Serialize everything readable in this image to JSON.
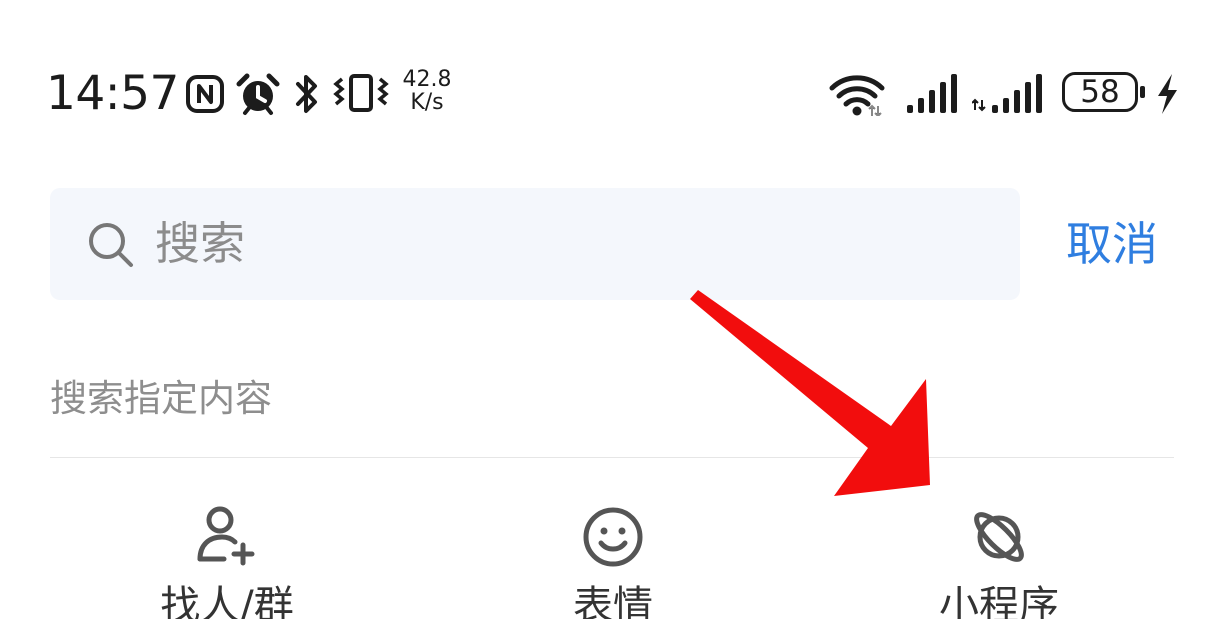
{
  "status_bar": {
    "time": "14:57",
    "net_speed_value": "42.8",
    "net_speed_unit": "K/s",
    "battery_level": "58",
    "icons": [
      "nfc-icon",
      "alarm-icon",
      "bluetooth-icon",
      "vibrate-icon",
      "wifi-icon",
      "signal-icon",
      "signal-icon",
      "battery-icon",
      "charging-icon"
    ]
  },
  "search": {
    "placeholder": "搜索",
    "value": "",
    "cancel_label": "取消"
  },
  "section": {
    "title": "搜索指定内容"
  },
  "categories": [
    {
      "label": "找人/群",
      "icon": "add-person-icon"
    },
    {
      "label": "表情",
      "icon": "smiley-icon"
    },
    {
      "label": "小程序",
      "icon": "mini-program-icon"
    }
  ],
  "colors": {
    "accent": "#2f7ee0",
    "search_bg": "#f4f7fc",
    "annotation_arrow": "#f20d0d",
    "icon_gray": "#555555"
  }
}
